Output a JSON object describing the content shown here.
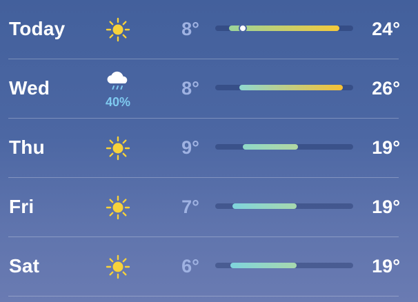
{
  "scale": {
    "min": 6,
    "max": 26
  },
  "rows": [
    {
      "day": "Today",
      "icon": "sun-icon",
      "precip": null,
      "low": "8°",
      "high": "24°",
      "low_value": 8,
      "high_value": 24,
      "current_value": 10,
      "bar_colors": [
        "#9bd49c",
        "#f5c93a"
      ]
    },
    {
      "day": "Wed",
      "icon": "cloud-rain-icon",
      "precip": "40%",
      "low": "8°",
      "high": "26°",
      "low_value": 9.5,
      "high_value": 24.5,
      "current_value": null,
      "bar_colors": [
        "#8fd8d0",
        "#f6c033"
      ]
    },
    {
      "day": "Thu",
      "icon": "sun-icon",
      "precip": null,
      "low": "9°",
      "high": "19°",
      "low_value": 10,
      "high_value": 18,
      "current_value": null,
      "bar_colors": [
        "#8fd8c8",
        "#b2d7a2"
      ]
    },
    {
      "day": "Fri",
      "icon": "sun-icon",
      "precip": null,
      "low": "7°",
      "high": "19°",
      "low_value": 8.5,
      "high_value": 17.8,
      "current_value": null,
      "bar_colors": [
        "#7fd4dd",
        "#a7d8ae"
      ]
    },
    {
      "day": "Sat",
      "icon": "sun-icon",
      "precip": null,
      "low": "6°",
      "high": "19°",
      "low_value": 8.2,
      "high_value": 17.8,
      "current_value": null,
      "bar_colors": [
        "#7fd4dd",
        "#a7d8ae"
      ]
    }
  ]
}
